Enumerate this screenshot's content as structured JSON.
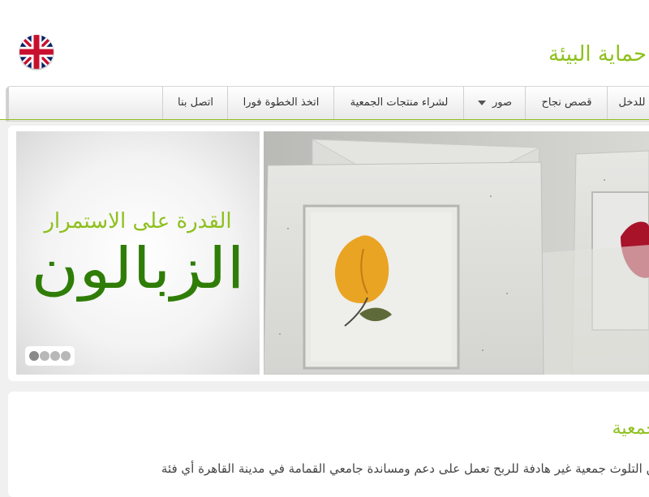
{
  "header": {
    "title": "جمعية حماية البيئة من التلوث",
    "visible_title": "طة حماية البيئة",
    "language_flag": "uk-flag-icon"
  },
  "nav": {
    "items": [
      {
        "label": "للدخل"
      },
      {
        "label": "قصص نجاح"
      },
      {
        "label": "صور",
        "dropdown": true
      },
      {
        "label": "لشراء منتجات الجمعية"
      },
      {
        "label": "اتخذ الخطوة فورا"
      },
      {
        "label": "اتصل بنا"
      }
    ]
  },
  "slider": {
    "tagline": "القدرة على الاستمرار",
    "brand": "الزبالون",
    "slides_count": 4,
    "active_slide": 1
  },
  "content": {
    "section_title": "جمعية",
    "paragraph": "من التلوث جمعية غير هادفة للربح تعمل على دعم ومساندة جامعي القمامة في مدينة القاهرة أي فئة"
  },
  "colors": {
    "accent": "#8ec01d",
    "brand_dark": "#2f7d07",
    "nav_text": "#333333"
  }
}
